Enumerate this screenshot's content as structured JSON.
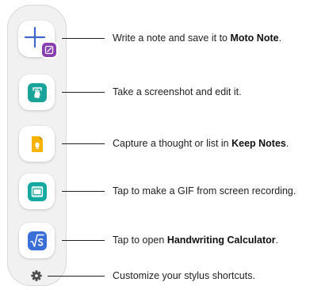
{
  "shortcuts": [
    {
      "icon": "moto-note-icon",
      "text_before": "Write a note and save it to ",
      "bold": "Moto Note",
      "text_after": "."
    },
    {
      "icon": "screenshot-edit-icon",
      "text_before": "Take a screenshot and edit it.",
      "bold": "",
      "text_after": ""
    },
    {
      "icon": "keep-notes-icon",
      "text_before": "Capture a thought or list in ",
      "bold": "Keep Notes",
      "text_after": "."
    },
    {
      "icon": "gif-recording-icon",
      "text_before": "Tap to make a GIF from screen recording.",
      "bold": "",
      "text_after": ""
    },
    {
      "icon": "handwriting-calculator-icon",
      "text_before": "Tap to open ",
      "bold": "Handwriting Calculator",
      "text_after": "."
    },
    {
      "icon": "gear-icon",
      "text_before": "Customize your stylus shortcuts.",
      "bold": "",
      "text_after": ""
    }
  ],
  "colors": {
    "moto_note_accent": "#3f67c9",
    "moto_note_badge": "#8a3fb0",
    "screenshot_teal": "#1aa39a",
    "keep_yellow": "#f6b400",
    "gif_teal": "#13a8a0",
    "calculator_blue": "#3a6fd8",
    "connector": "#1f1f1f"
  }
}
